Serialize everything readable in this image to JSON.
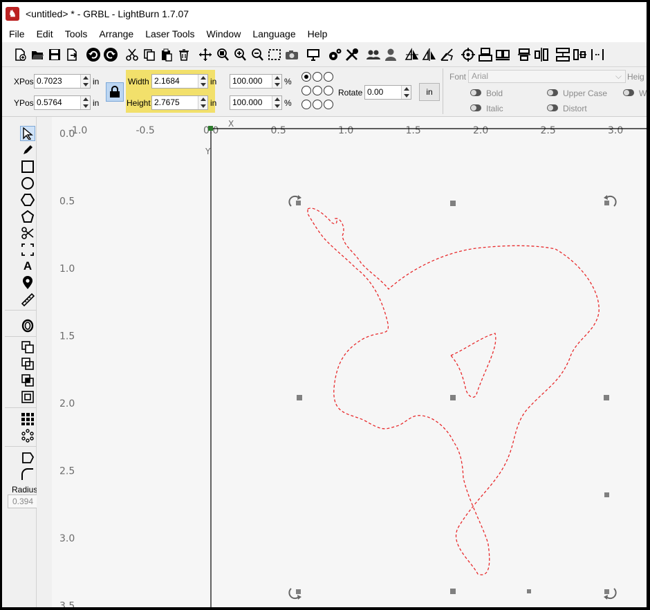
{
  "window": {
    "title": "<untitled> * - GRBL - LightBurn 1.7.07",
    "app_icon": "lightburn-icon"
  },
  "menu": [
    "File",
    "Edit",
    "Tools",
    "Arrange",
    "Laser Tools",
    "Window",
    "Language",
    "Help"
  ],
  "toolbar": {
    "groups": [
      [
        "new-file-icon",
        "open-file-icon",
        "save-file-icon",
        "import-icon",
        "undo-icon",
        "redo-icon",
        "cut-icon",
        "copy-icon",
        "paste-icon",
        "delete-icon",
        "move-icon",
        "zoom-to-page-icon",
        "zoom-in-icon",
        "zoom-out-icon",
        "select-all-icon",
        "camera-icon",
        "frame-monitor-icon",
        "settings-gear-icon",
        "tools-icon",
        "group-icon",
        "user-icon",
        "mirror-h-icon",
        "mirror-v-icon",
        "rotate-icon",
        "target-icon",
        "align-icon",
        "align-bottom-icon",
        "align-left-icon",
        "distribute-h-icon",
        "distribute-v-icon",
        "move-together-icon",
        "dock-icon"
      ]
    ]
  },
  "props": {
    "xpos": {
      "label": "XPos",
      "value": "0.7023",
      "unit": "in"
    },
    "ypos": {
      "label": "YPos",
      "value": "0.5764",
      "unit": "in"
    },
    "width": {
      "label": "Width",
      "value": "2.1684",
      "unit": "in"
    },
    "height": {
      "label": "Height",
      "value": "2.7675",
      "unit": "in"
    },
    "scale_w": {
      "value": "100.000",
      "unit": "%"
    },
    "scale_h": {
      "value": "100.000",
      "unit": "%"
    },
    "rotate": {
      "label": "Rotate",
      "value": "0.00"
    },
    "unit_button": "in",
    "lock_icon": "lock-icon",
    "font_label": "Font",
    "font_value": "Arial",
    "height_label": "Heig",
    "bold": "Bold",
    "italic": "Italic",
    "upper_case": "Upper Case",
    "distort": "Distort",
    "w_clip": "W"
  },
  "left_tools": [
    "select-arrow-icon",
    "pencil-icon",
    "rectangle-icon",
    "ellipse-icon",
    "polygon-icon",
    "pentagon-icon",
    "edit-nodes-icon",
    "position-laser-icon",
    "text-icon",
    "marker-icon",
    "measure-icon",
    "offset-icon",
    "weld-icon",
    "subtract-icon",
    "intersect-icon",
    "clip-icon",
    "grid-array-icon",
    "circular-array-icon",
    "corner-icon",
    "fillet-icon"
  ],
  "radius": {
    "label": "Radius:",
    "value": "0.394"
  },
  "ruler": {
    "top_labels": [
      "-1.0",
      "-0.5",
      "0.0",
      "0.5",
      "1.0",
      "1.5",
      "2.0",
      "2.5",
      "3.0"
    ],
    "left_labels": [
      "0.0",
      "0.5",
      "1.0",
      "1.5",
      "2.0",
      "2.5",
      "3.0",
      "3.5"
    ],
    "x_axis_letter": "X",
    "y_axis_letter": "Y"
  },
  "colors": {
    "selection_highlight": "#f2e06b",
    "shape_stroke": "#e8292b",
    "handle": "#808080",
    "canvas_bg": "#f6f6f6"
  }
}
